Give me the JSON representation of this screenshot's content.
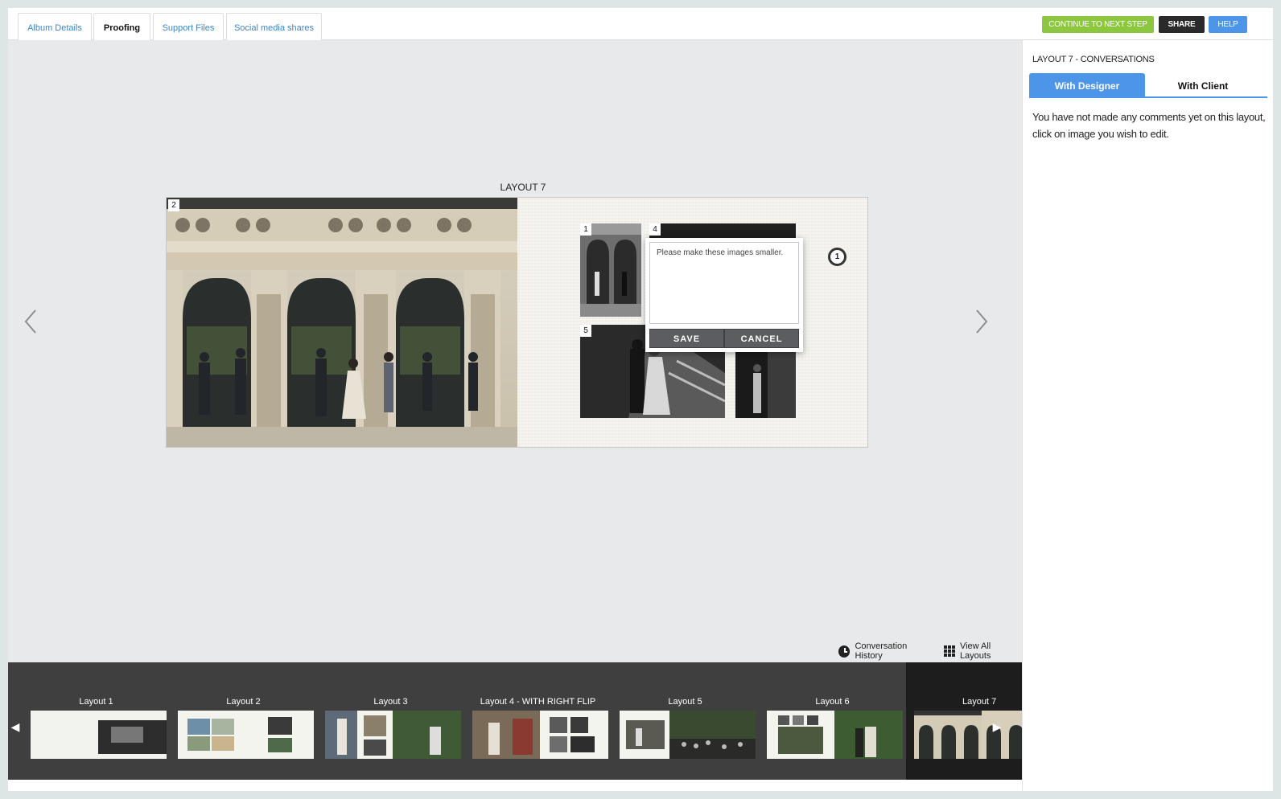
{
  "tabs": [
    {
      "label": "Album Details",
      "active": false
    },
    {
      "label": "Proofing",
      "active": true
    },
    {
      "label": "Support Files",
      "active": false
    },
    {
      "label": "Social media shares",
      "active": false
    }
  ],
  "toolbar": {
    "continue_label": "CONTINUE TO NEXT STEP",
    "share_label": "SHARE",
    "help_label": "HELP"
  },
  "colors": {
    "continue": "#8dc63f",
    "share": "#2a2a2a",
    "help": "#4d95e8",
    "active_tab": "#4d95e8"
  },
  "canvas": {
    "layout_title": "LAYOUT 7",
    "prev_icon": "chevron-left-icon",
    "next_icon": "chevron-right-icon"
  },
  "spread": {
    "images": [
      {
        "number": "2"
      },
      {
        "number": "1"
      },
      {
        "number": "4"
      },
      {
        "number": "5"
      }
    ]
  },
  "comment": {
    "text": "Please make these images smaller.",
    "save_label": "SAVE",
    "cancel_label": "CANCEL",
    "marker": "1"
  },
  "links": {
    "history_label": "Conversation History",
    "all_layouts_label": "View All Layouts"
  },
  "filmstrip": {
    "items": [
      {
        "label": "Layout 1"
      },
      {
        "label": "Layout 2"
      },
      {
        "label": "Layout 3"
      },
      {
        "label": "Layout 4 - WITH RIGHT FLIP"
      },
      {
        "label": "Layout 5"
      },
      {
        "label": "Layout 6"
      },
      {
        "label": "Layout 7",
        "active": true
      }
    ]
  },
  "panel": {
    "title": "LAYOUT 7 - CONVERSATIONS",
    "tab_designer": "With Designer",
    "tab_client": "With Client",
    "message": "You have not made any comments yet on this layout, click on image you wish to edit."
  }
}
